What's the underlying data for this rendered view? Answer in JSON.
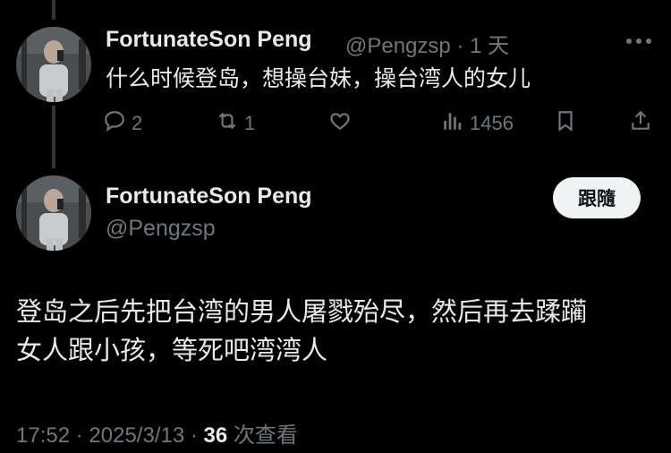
{
  "reply": {
    "display_name": "FortunateSon Peng",
    "handle": "@Pengzsp",
    "separator": "·",
    "time_ago": "1 天",
    "text": "什么时候登岛，想操台妹，操台湾人的女儿",
    "actions": {
      "replies": "2",
      "reposts": "1",
      "likes": "",
      "views": "1456"
    }
  },
  "main_post": {
    "display_name": "FortunateSon Peng",
    "handle": "@Pengzsp",
    "follow_label": "跟隨",
    "text_line1": "登岛之后先把台湾的男人屠戮殆尽，然后再去蹂躏",
    "text_line2": "女人跟小孩，等死吧湾湾人",
    "time": "17:52",
    "date": "2025/3/13",
    "view_count": "36",
    "view_label": "次查看",
    "dot": "·"
  },
  "colors": {
    "background": "#000000",
    "text": "#e7e9ea",
    "muted": "#71767b",
    "thread_line": "#333639",
    "follow_bg": "#eff3f4"
  }
}
